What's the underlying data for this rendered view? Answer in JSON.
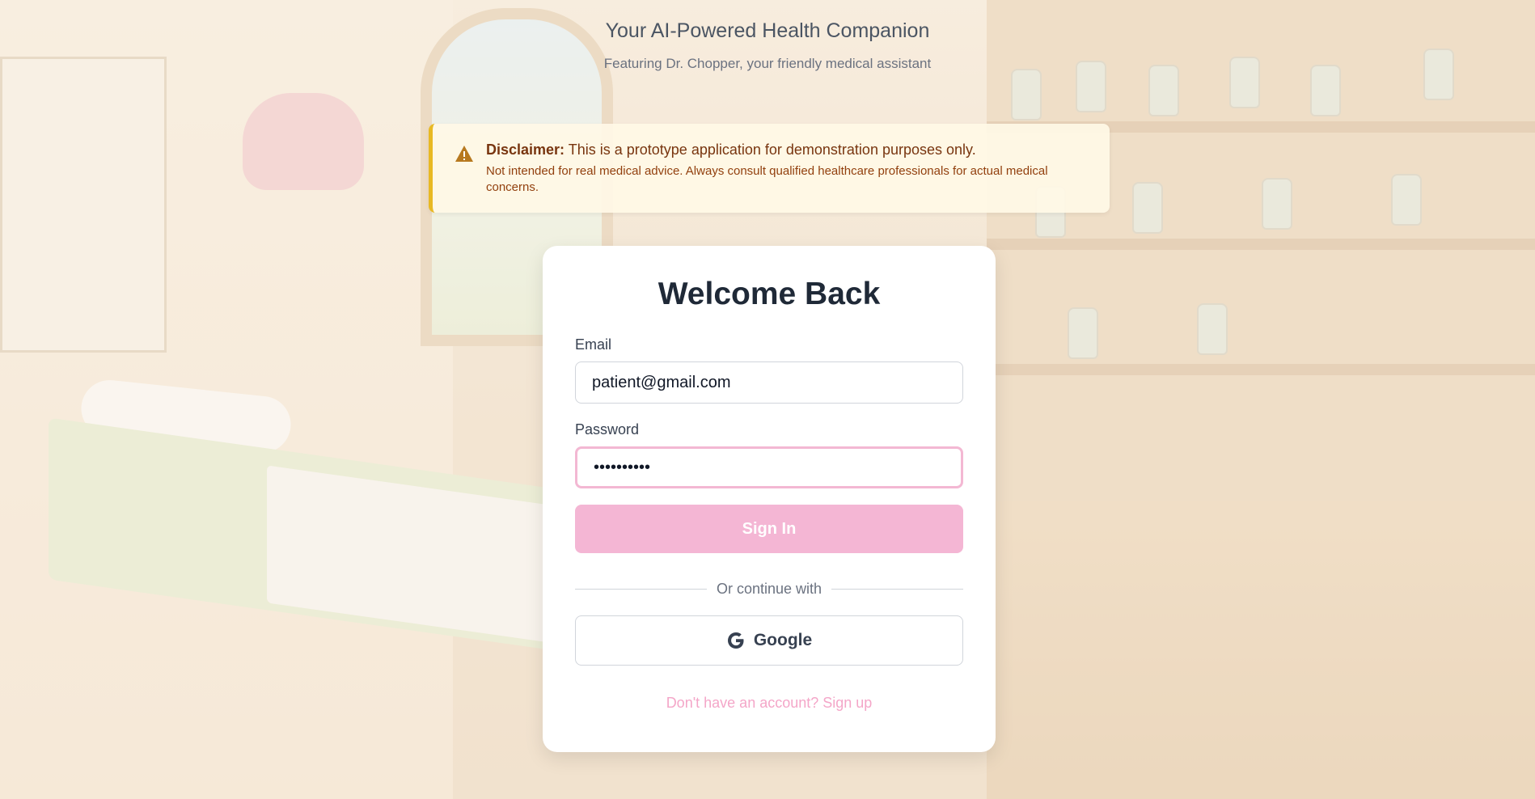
{
  "header": {
    "title": "Your AI-Powered Health Companion",
    "subtitle": "Featuring Dr. Chopper, your friendly medical assistant"
  },
  "disclaimer": {
    "icon": "warning-icon",
    "heading": "Disclaimer:",
    "text": "This is a prototype application for demonstration purposes only.",
    "detail": "Not intended for real medical advice. Always consult qualified healthcare professionals for actual medical concerns.",
    "accent_color": "#e8b923"
  },
  "login": {
    "title": "Welcome Back",
    "email_label": "Email",
    "email_value": "patient@gmail.com",
    "password_label": "Password",
    "password_value": "••••••••••",
    "signin_label": "Sign In",
    "divider_text": "Or continue with",
    "google_label": "Google",
    "google_icon": "google-icon",
    "signup_link": "Don't have an account? Sign up",
    "accent_color": "#f4b6d4"
  }
}
